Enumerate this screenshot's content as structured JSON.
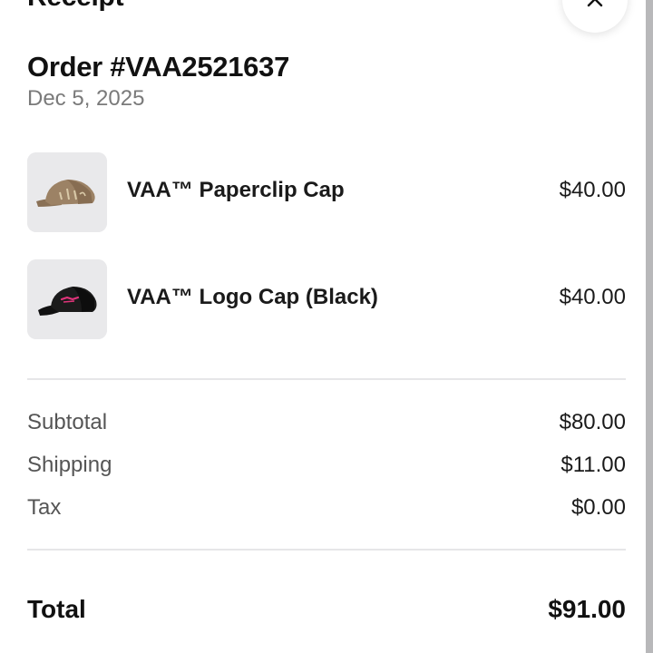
{
  "sheet": {
    "title": "Receipt"
  },
  "order": {
    "title": "Order #VAA2521637",
    "date": "Dec 5, 2025"
  },
  "items": [
    {
      "name": "VAA™ Paperclip Cap",
      "price": "$40.00",
      "thumb_icon": "tan-cap-image"
    },
    {
      "name": "VAA™ Logo Cap (Black)",
      "price": "$40.00",
      "thumb_icon": "black-cap-image"
    }
  ],
  "summary": {
    "subtotal_label": "Subtotal",
    "subtotal_value": "$80.00",
    "shipping_label": "Shipping",
    "shipping_value": "$11.00",
    "tax_label": "Tax",
    "tax_value": "$0.00"
  },
  "total": {
    "label": "Total",
    "value": "$91.00"
  },
  "colors": {
    "background": "#ffffff",
    "text_primary": "#1a1a1a",
    "text_secondary": "#7a7a7a",
    "divider": "#e6e6e8",
    "thumb_bg": "#e9e9eb"
  }
}
